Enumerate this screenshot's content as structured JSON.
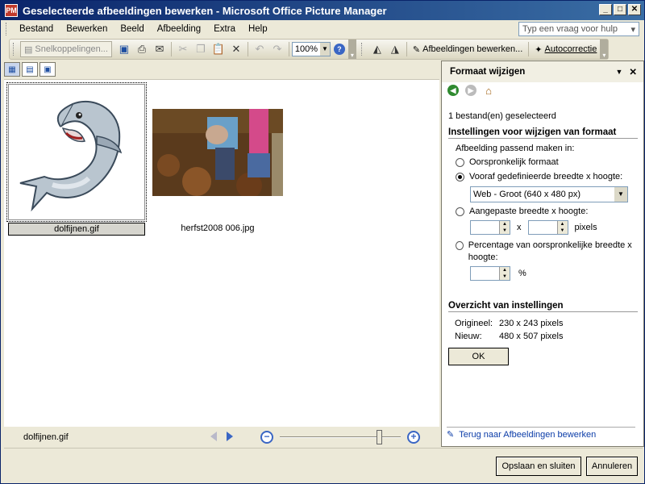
{
  "window": {
    "title": "Geselecteerde afbeeldingen bewerken - Microsoft Office Picture Manager",
    "app_icon_label": "PM",
    "minimize": "_",
    "maximize": "□",
    "close": "✕"
  },
  "menu": {
    "items": [
      {
        "label": "Bestand"
      },
      {
        "label": "Bewerken"
      },
      {
        "label": "Beeld"
      },
      {
        "label": "Afbeelding"
      },
      {
        "label": "Extra"
      },
      {
        "label": "Help"
      }
    ],
    "help_placeholder": "Typ een vraag voor hulp"
  },
  "toolbar": {
    "shortcuts_label": "Snelkoppelingen...",
    "zoom_value": "100%",
    "edit_pictures_label": "Afbeeldingen bewerken...",
    "autocorrect_label": "Autocorrectie"
  },
  "thumbnails": [
    {
      "caption": "dolfijnen.gif",
      "selected": true
    },
    {
      "caption": "herfst2008 006.jpg",
      "selected": false
    }
  ],
  "status": {
    "filename": "dolfijnen.gif",
    "zoom_slider_fraction": 0.82
  },
  "panel": {
    "title": "Formaat wijzigen",
    "selected_count_text": "1 bestand(en) geselecteerd",
    "settings_heading": "Instellingen voor wijzigen van formaat",
    "fit_label": "Afbeelding passend maken in:",
    "opt_original": "Oorspronkelijk formaat",
    "opt_predefined": "Vooraf gedefinieerde breedte x hoogte:",
    "predefined_value": "Web - Groot (640 x 480 px)",
    "opt_custom": "Aangepaste breedte x hoogte:",
    "custom_x": "x",
    "custom_unit": "pixels",
    "opt_percentage": "Percentage van oorspronkelijke breedte x hoogte:",
    "percent_unit": "%",
    "summary_heading": "Overzicht van instellingen",
    "original_label": "Origineel:",
    "original_value": "230 x 243 pixels",
    "new_label": "Nieuw:",
    "new_value": "480 x 507 pixels",
    "ok_label": "OK",
    "back_link": "Terug naar Afbeeldingen bewerken"
  },
  "buttons": {
    "save_close": "Opslaan en sluiten",
    "cancel": "Annuleren"
  }
}
